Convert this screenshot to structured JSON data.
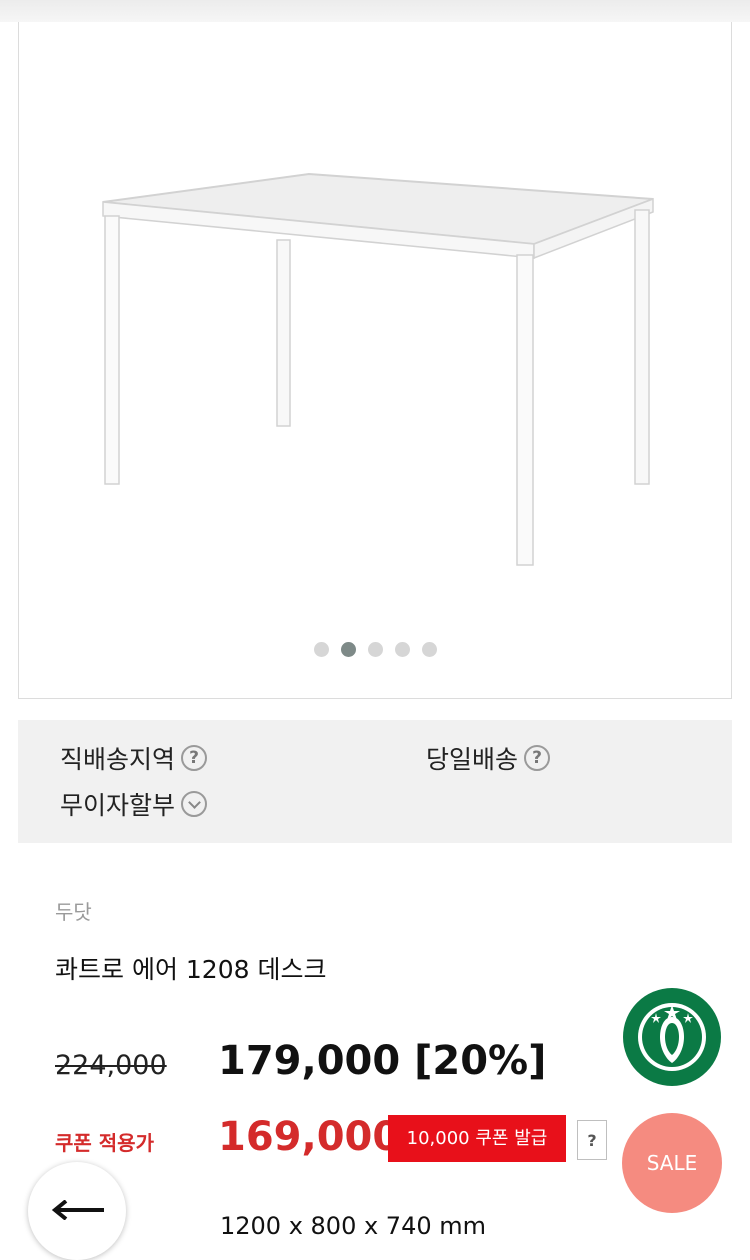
{
  "gallery": {
    "dots": [
      false,
      true,
      false,
      false,
      false
    ]
  },
  "delivery": {
    "direct_area": "직배송지역",
    "same_day": "당일배송",
    "installment": "무이자할부",
    "help_symbol": "?"
  },
  "product": {
    "brand": "두닷",
    "name": "콰트로 에어 1208 데스크",
    "original_price": "224,000",
    "sale_price": "179,000 [20%]",
    "coupon_label": "쿠폰 적용가",
    "coupon_price": "169,000",
    "coupon_button": "10,000 쿠폰 발급",
    "coupon_help": "?",
    "dimensions": "1200 x 800 x 740 mm"
  },
  "badges": {
    "sale": "SALE",
    "logo_icon": "starbucks-logo-icon",
    "back_icon": "arrow-left-icon"
  }
}
